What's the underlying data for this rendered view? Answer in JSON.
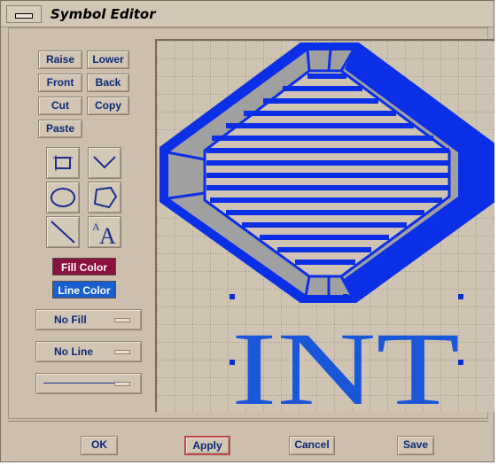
{
  "window": {
    "title": "Symbol Editor"
  },
  "left_panel": {
    "buttons": [
      {
        "label": "Raise"
      },
      {
        "label": "Lower"
      },
      {
        "label": "Front"
      },
      {
        "label": "Back"
      },
      {
        "label": "Cut"
      },
      {
        "label": "Copy"
      },
      {
        "label": "Paste"
      }
    ],
    "tools": [
      {
        "icon": "rectangle-tool-icon"
      },
      {
        "icon": "polyline-tool-icon"
      },
      {
        "icon": "ellipse-tool-icon"
      },
      {
        "icon": "polygon-tool-icon"
      },
      {
        "icon": "line-tool-icon"
      },
      {
        "icon": "text-tool-icon",
        "glyph": "A",
        "glyph_small": "A"
      }
    ],
    "fill_color": {
      "label": "Fill Color",
      "color": "#8c1040"
    },
    "line_color": {
      "label": "Line Color",
      "color": "#1a5fd0"
    },
    "fill_option": {
      "value": "No Fill"
    },
    "line_option": {
      "value": "No Line"
    }
  },
  "canvas": {
    "text": "INT",
    "symbol_color": "#0a2fe6",
    "fill_gray": "#a0a0a0"
  },
  "footer": {
    "ok": "OK",
    "apply": "Apply",
    "cancel": "Cancel",
    "save": "Save"
  }
}
